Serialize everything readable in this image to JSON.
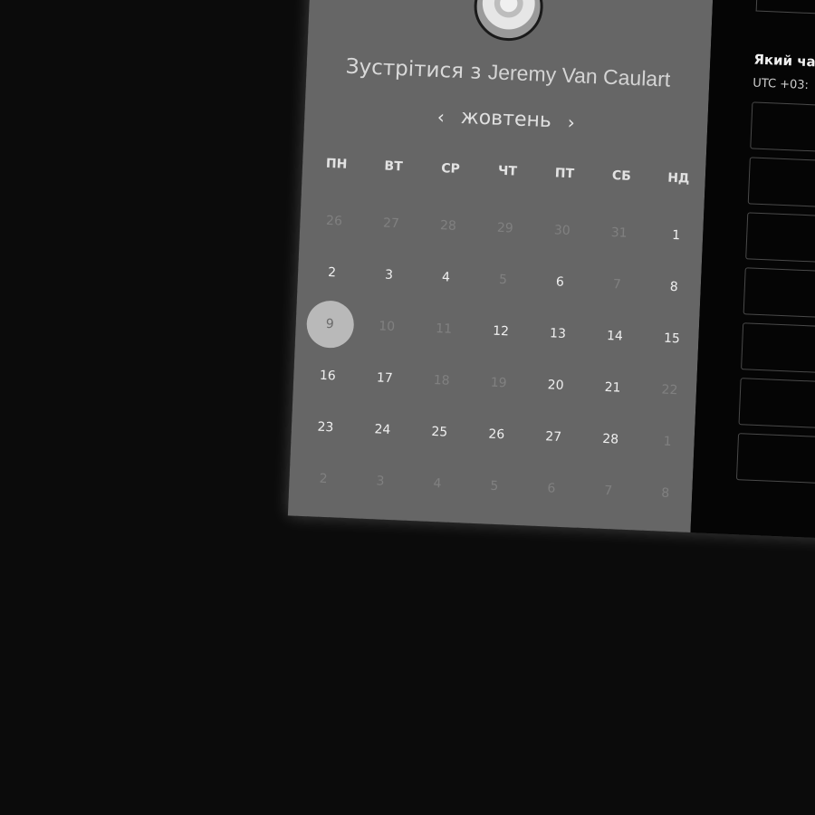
{
  "calendar": {
    "title_prefix": "Зустрітися з",
    "person_name": "Jeremy Van Caulart",
    "month": "жовтень",
    "prev_arrow": "‹",
    "next_arrow": "›",
    "weekdays": [
      "ПН",
      "ВТ",
      "СР",
      "ЧТ",
      "ПТ",
      "СБ",
      "НД"
    ],
    "weeks": [
      [
        {
          "d": "26",
          "s": "inactive"
        },
        {
          "d": "27",
          "s": "inactive"
        },
        {
          "d": "28",
          "s": "inactive"
        },
        {
          "d": "29",
          "s": "inactive"
        },
        {
          "d": "30",
          "s": "inactive"
        },
        {
          "d": "31",
          "s": "inactive"
        },
        {
          "d": "1",
          "s": "active"
        }
      ],
      [
        {
          "d": "2",
          "s": "active"
        },
        {
          "d": "3",
          "s": "active"
        },
        {
          "d": "4",
          "s": "active"
        },
        {
          "d": "5",
          "s": "inactive"
        },
        {
          "d": "6",
          "s": "active"
        },
        {
          "d": "7",
          "s": "inactive"
        },
        {
          "d": "8",
          "s": "active"
        }
      ],
      [
        {
          "d": "9",
          "s": "selected"
        },
        {
          "d": "10",
          "s": "inactive"
        },
        {
          "d": "11",
          "s": "inactive"
        },
        {
          "d": "12",
          "s": "active"
        },
        {
          "d": "13",
          "s": "active"
        },
        {
          "d": "14",
          "s": "active"
        },
        {
          "d": "15",
          "s": "active"
        }
      ],
      [
        {
          "d": "16",
          "s": "active"
        },
        {
          "d": "17",
          "s": "active"
        },
        {
          "d": "18",
          "s": "inactive"
        },
        {
          "d": "19",
          "s": "inactive"
        },
        {
          "d": "20",
          "s": "active"
        },
        {
          "d": "21",
          "s": "active"
        },
        {
          "d": "22",
          "s": "inactive"
        }
      ],
      [
        {
          "d": "23",
          "s": "active"
        },
        {
          "d": "24",
          "s": "active"
        },
        {
          "d": "25",
          "s": "active"
        },
        {
          "d": "26",
          "s": "active"
        },
        {
          "d": "27",
          "s": "active"
        },
        {
          "d": "28",
          "s": "active"
        },
        {
          "d": "1",
          "s": "inactive"
        }
      ],
      [
        {
          "d": "2",
          "s": "inactive"
        },
        {
          "d": "3",
          "s": "inactive"
        },
        {
          "d": "4",
          "s": "inactive"
        },
        {
          "d": "5",
          "s": "inactive"
        },
        {
          "d": "6",
          "s": "inactive"
        },
        {
          "d": "7",
          "s": "inactive"
        },
        {
          "d": "8",
          "s": "inactive"
        }
      ]
    ]
  },
  "slots": {
    "heading": "Який ча",
    "timezone": "UTC +03:",
    "count": 7
  },
  "colors": {
    "calendar_bg": "#666666",
    "slot_panel_bg": "#050505",
    "page_bg": "#0b0b0b",
    "selected_day_bg": "#b9b9b9"
  }
}
